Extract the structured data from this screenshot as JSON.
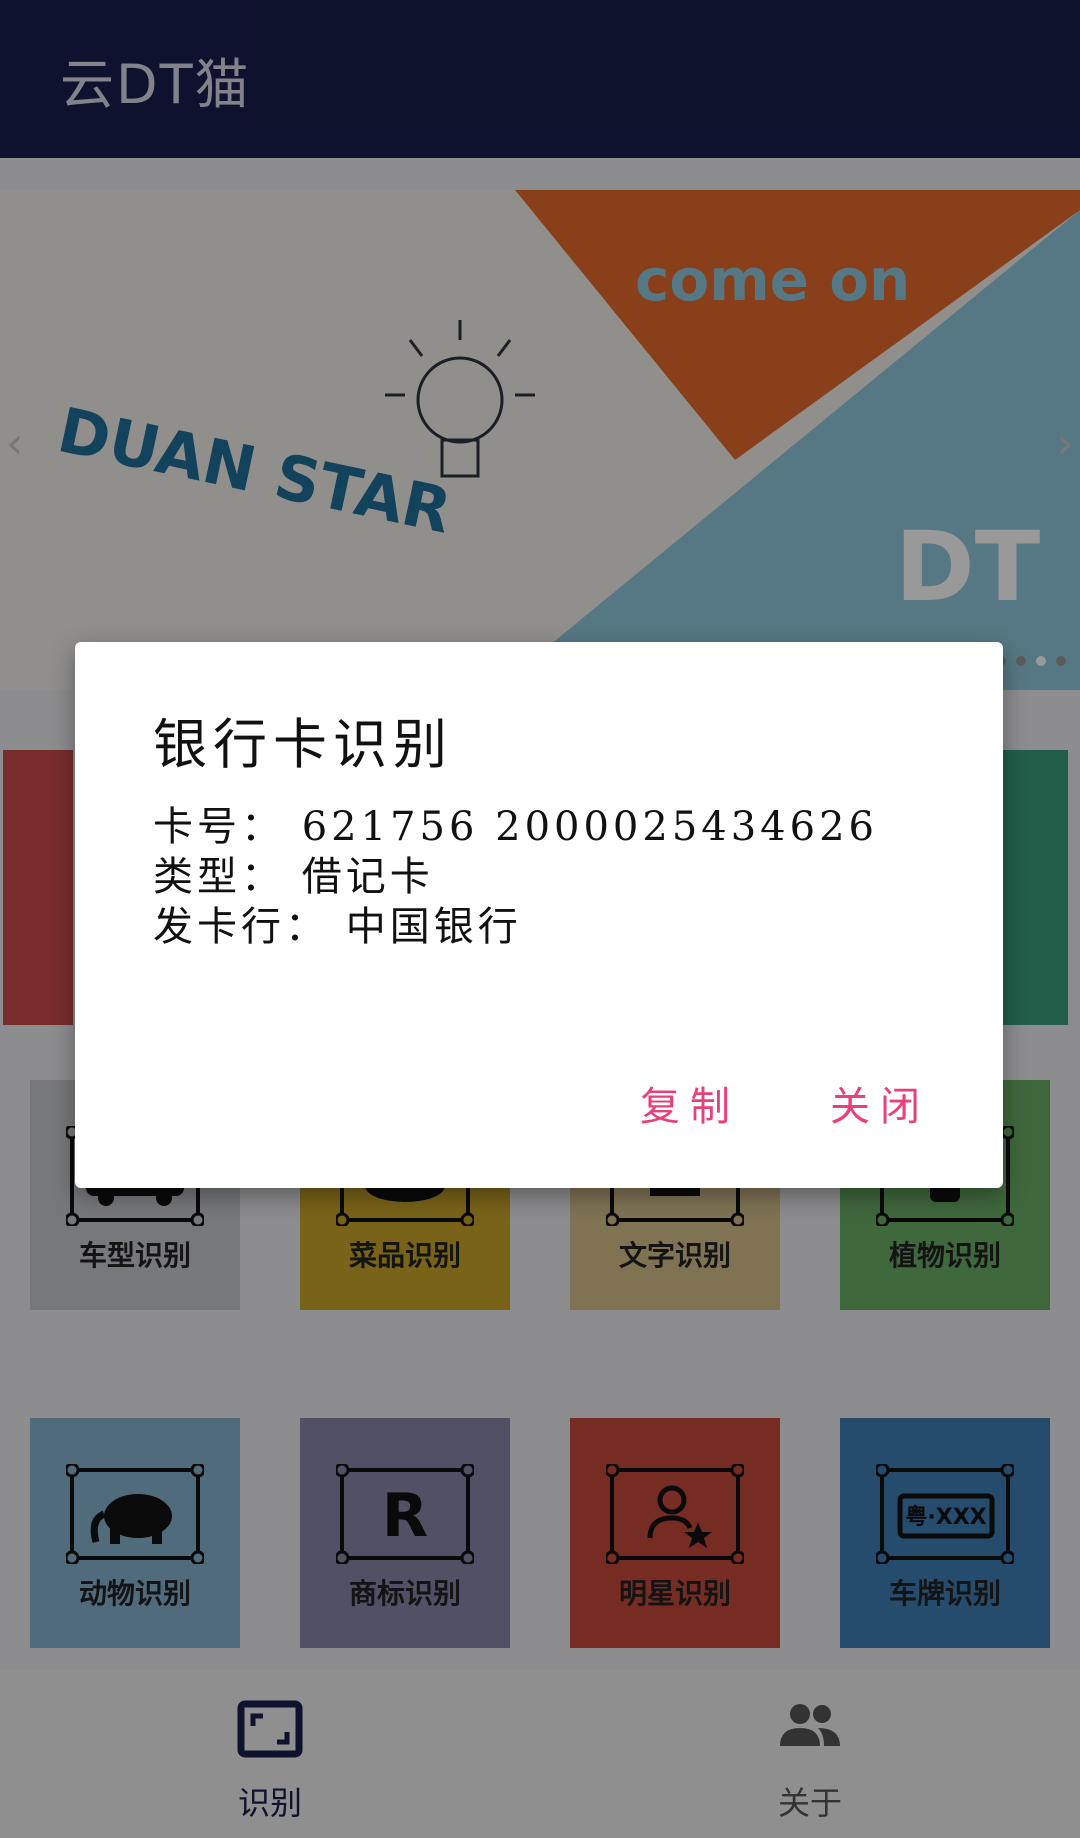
{
  "app": {
    "title": "云DT猫"
  },
  "banner": {
    "text_left": "DUAN STAR",
    "text_top": "come on",
    "text_right": "DT",
    "dots": 5,
    "active_dot": 4
  },
  "tiles": [
    {
      "label": "车型识别",
      "icon": "car-icon",
      "color": "#c7c8cf"
    },
    {
      "label": "菜品识别",
      "icon": "dish-icon",
      "color": "#c8a52a"
    },
    {
      "label": "文字识别",
      "icon": "text-icon",
      "color": "#d6c08c"
    },
    {
      "label": "植物识别",
      "icon": "plant-icon",
      "color": "#6aae66"
    },
    {
      "label": "动物识别",
      "icon": "elephant-icon",
      "color": "#86b5cf"
    },
    {
      "label": "商标识别",
      "icon": "trademark-icon",
      "color": "#8885a8"
    },
    {
      "label": "明星识别",
      "icon": "star-person-icon",
      "color": "#c54a3a"
    },
    {
      "label": "车牌识别",
      "icon": "license-plate-icon",
      "color": "#3f7fb5",
      "plate_text": "粤·XXX",
      "trademark_text": "R"
    }
  ],
  "bottom_nav": {
    "items": [
      {
        "label": "识别",
        "icon": "scan-frame-icon",
        "color": "#1a1f4d"
      },
      {
        "label": "关于",
        "icon": "people-icon",
        "color": "#555555"
      }
    ]
  },
  "dialog": {
    "title": "银行卡识别",
    "card_number_label": "卡号：",
    "card_number": "621756 2000025434626",
    "card_type_label": "类型：",
    "card_type": "借记卡",
    "issuer_label": "发卡行：",
    "issuer": "中国银行",
    "copy_button": "复制",
    "close_button": "关闭"
  }
}
